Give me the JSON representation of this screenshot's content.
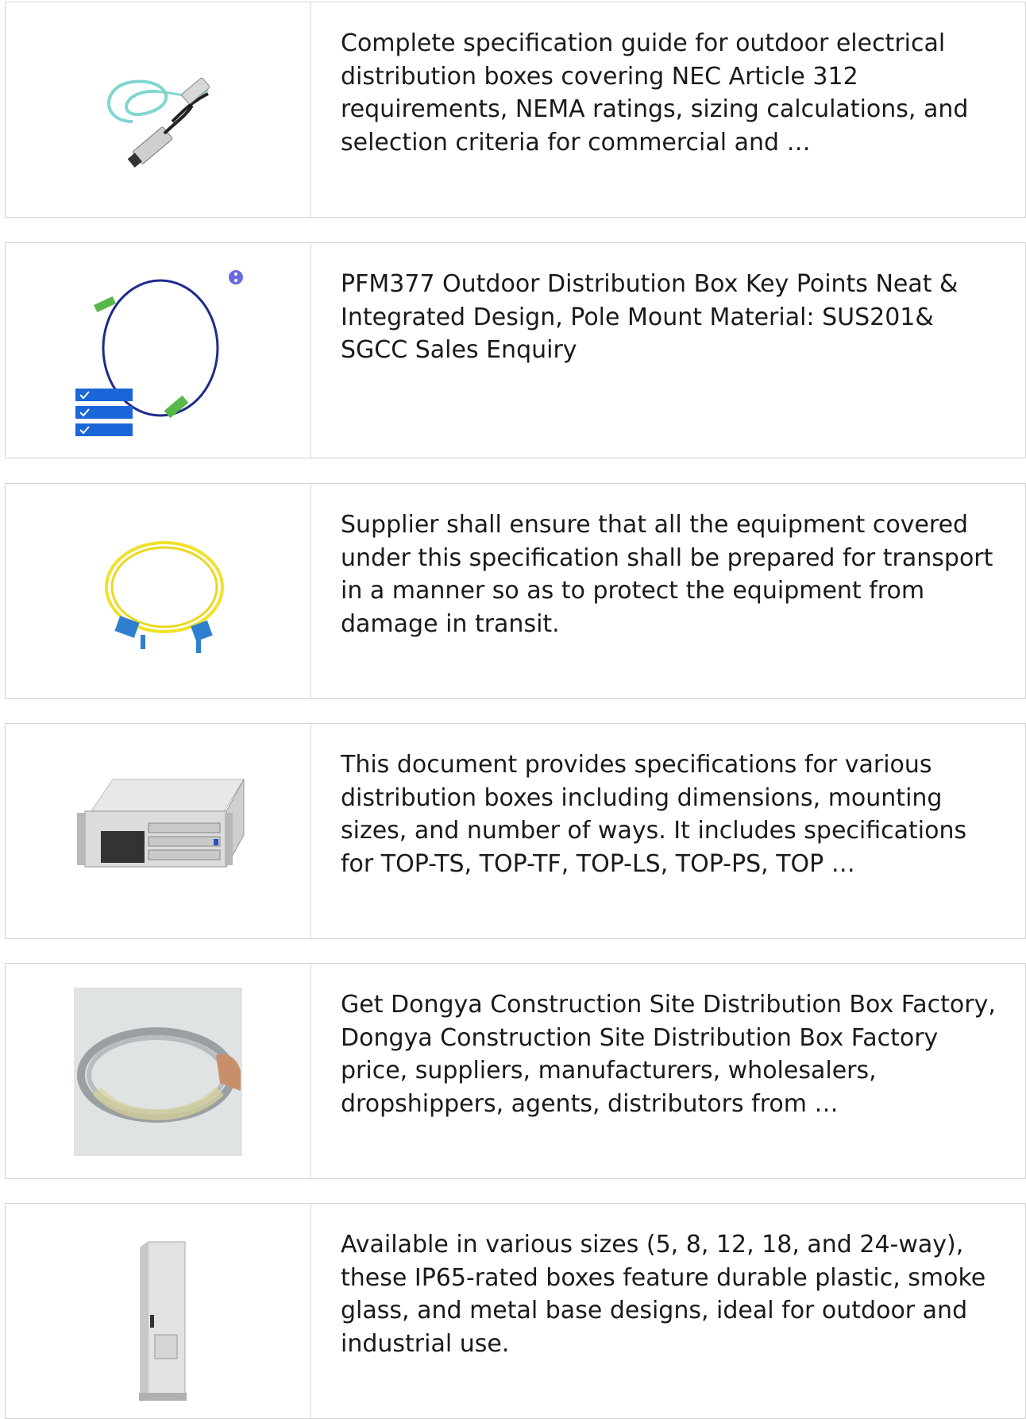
{
  "results": [
    {
      "image": "fiber-aoc-cable-image",
      "description": "Complete specification guide for outdoor electrical distribution boxes covering NEC Article 312 requirements, NEMA ratings, sizing calculations, and selection criteria for commercial and …"
    },
    {
      "image": "blue-patch-cord-image",
      "description": "PFM377 Outdoor Distribution Box Key Points Neat & Integrated Design, Pole Mount Material: SUS201& SGCC Sales Enquiry"
    },
    {
      "image": "yellow-patch-cord-image",
      "description": "Supplier shall ensure that all the equipment covered under this specification shall be prepared for transport in a manner so as to protect the equipment from damage in transit."
    },
    {
      "image": "rack-chassis-image",
      "description": "This document provides specifications for various distribution boxes including dimensions, mounting sizes, and number of ways. It includes specifications for TOP-TS, TOP-TF, TOP-LS, TOP-PS, TOP …"
    },
    {
      "image": "grey-cable-coil-image",
      "description": "Get Dongya Construction Site Distribution Box Factory, Dongya Construction Site Distribution Box Factory price, suppliers, manufacturers, wholesalers, dropshippers, agents, distributors from …"
    },
    {
      "image": "cabinet-enclosure-image",
      "description": "Available in various sizes (5, 8, 12, 18, and 24-way), these IP65-rated boxes feature durable plastic, smoke glass, and metal base designs, ideal for outdoor and industrial use."
    }
  ]
}
